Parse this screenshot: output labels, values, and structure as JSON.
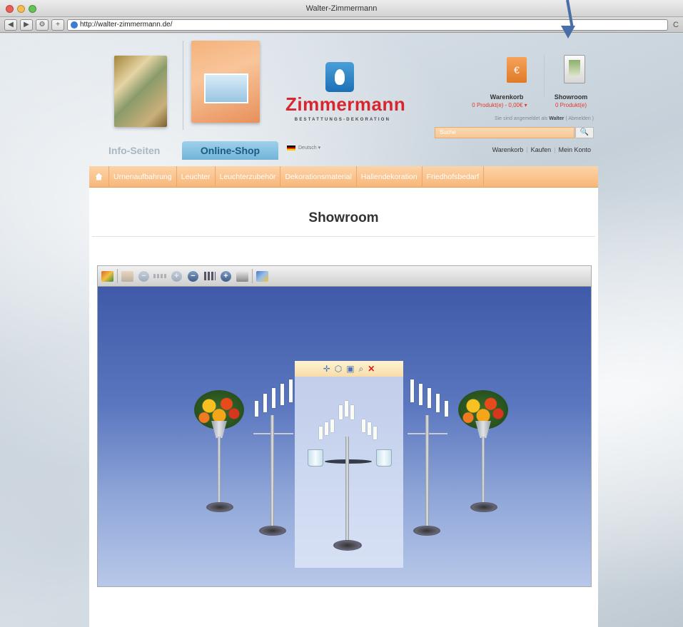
{
  "window": {
    "title": "Walter-Zimmermann"
  },
  "browser": {
    "url": "http://walter-zimmermann.de/",
    "back": "◀",
    "forward": "▶",
    "add": "+",
    "reload": "C"
  },
  "brand": {
    "name": "Zimmermann",
    "subtitle": "BESTATTUNGS-DEKORATION"
  },
  "header": {
    "cart_icon": "€",
    "cart_title": "Warenkorb",
    "cart_summary": "0 Produkt(e) - 0,00€ ▾",
    "showroom_title": "Showroom",
    "showroom_summary": "0 Produkt(e)",
    "logged_prefix": "Sie sind angemeldet als",
    "logged_user": "Walter",
    "logout": "( Abmelden )",
    "search_placeholder": "Suche",
    "search_button": "🔍",
    "links": [
      "Warenkorb",
      "Kaufen",
      "Mein Konto"
    ]
  },
  "tabs": {
    "info": "Info-Seiten",
    "shop": "Online-Shop",
    "language": "Deutsch ▾"
  },
  "nav": {
    "items": [
      "Urnenaufbahrung",
      "Leuchter",
      "Leuchterzubehör",
      "Dekorationsmaterial",
      "Hallendekoration",
      "Friedhofsbedarf"
    ]
  },
  "content": {
    "title": "Showroom"
  },
  "viewer": {
    "selection_toolbar": {
      "move": "✛",
      "zoom_minus": "−",
      "zoom_plus": "+",
      "delete": "✕"
    }
  },
  "colors": {
    "brand_red": "#d8262e",
    "nav_orange": "#f8b77a",
    "tab_blue": "#72b4d8",
    "stage_blue": "#3f5aa8"
  }
}
